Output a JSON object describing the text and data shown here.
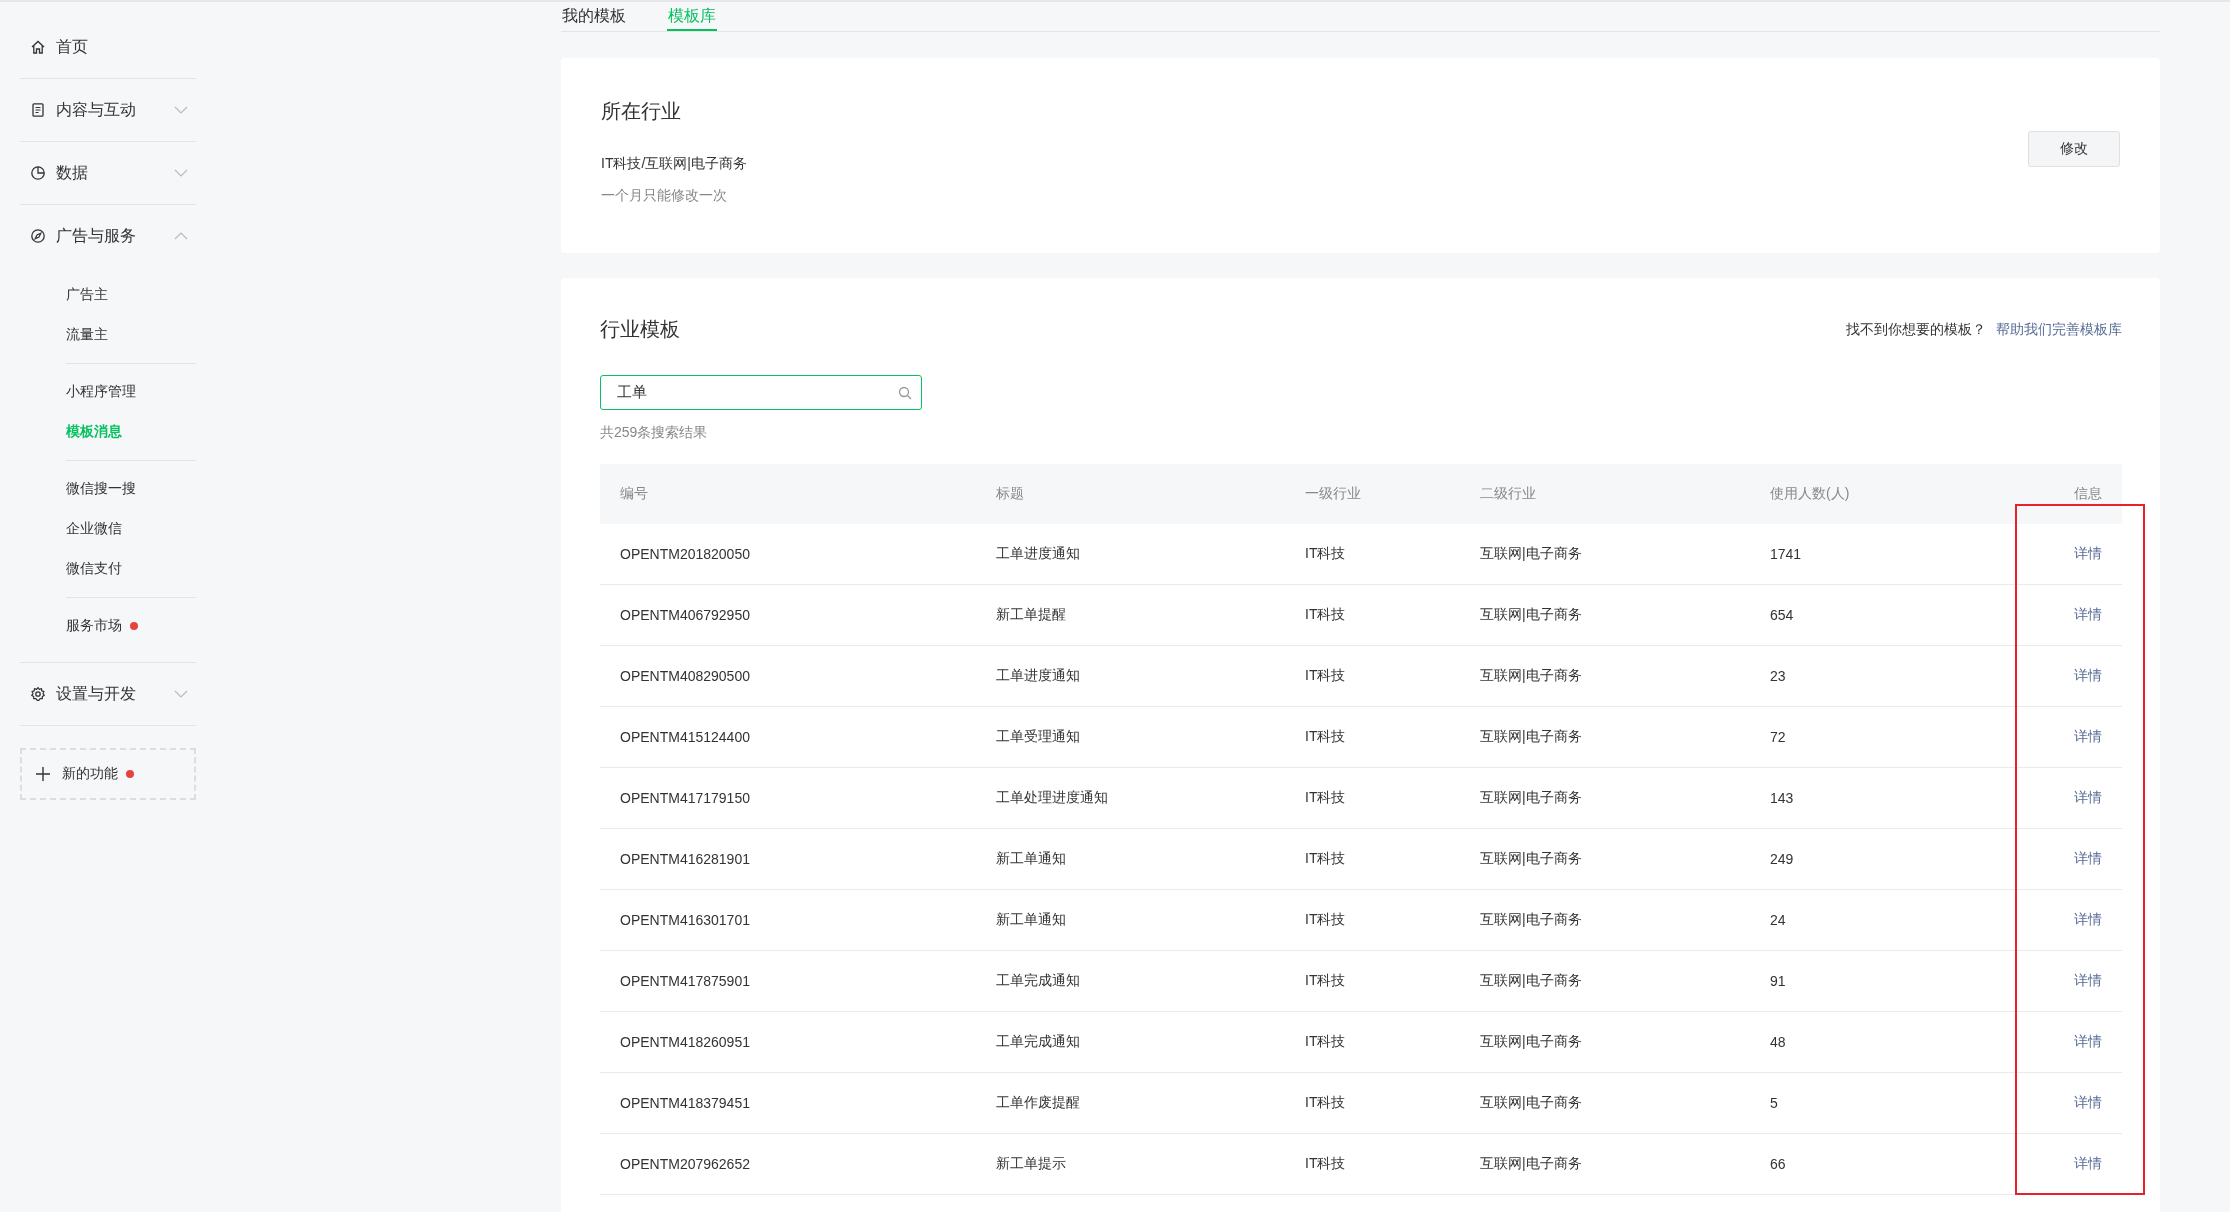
{
  "sidebar": {
    "items": [
      {
        "label": "首页"
      },
      {
        "label": "内容与互动",
        "expanded": false
      },
      {
        "label": "数据",
        "expanded": false
      },
      {
        "label": "广告与服务",
        "expanded": true,
        "groups": [
          {
            "items": [
              {
                "label": "广告主",
                "selected": false,
                "badge": false
              },
              {
                "label": "流量主",
                "selected": false,
                "badge": false
              }
            ]
          },
          {
            "items": [
              {
                "label": "小程序管理",
                "selected": false,
                "badge": false
              },
              {
                "label": "模板消息",
                "selected": true,
                "badge": false
              }
            ]
          },
          {
            "items": [
              {
                "label": "微信搜一搜",
                "selected": false,
                "badge": false
              },
              {
                "label": "企业微信",
                "selected": false,
                "badge": false
              },
              {
                "label": "微信支付",
                "selected": false,
                "badge": false
              }
            ]
          },
          {
            "items": [
              {
                "label": "服务市场",
                "selected": false,
                "badge": true
              }
            ]
          }
        ]
      },
      {
        "label": "设置与开发",
        "expanded": false
      }
    ],
    "new_feature": {
      "label": "新的功能",
      "badge": true
    }
  },
  "tabs": [
    {
      "label": "我的模板",
      "selected": false
    },
    {
      "label": "模板库",
      "selected": true
    }
  ],
  "industry_card": {
    "title": "所在行业",
    "industry": "IT科技/互联网|电子商务",
    "hint": "一个月只能修改一次",
    "button": "修改"
  },
  "template_card": {
    "title": "行业模板",
    "help_text": "找不到你想要的模板？",
    "help_link": "帮助我们完善模板库",
    "search": {
      "value": "工单"
    },
    "result_count": "共259条搜索结果",
    "table": {
      "highlight_last_column": true,
      "columns": [
        {
          "label": "编号"
        },
        {
          "label": "标题"
        },
        {
          "label": "一级行业"
        },
        {
          "label": "二级行业"
        },
        {
          "label": "使用人数(人)"
        },
        {
          "label": "信息"
        }
      ],
      "rows": [
        [
          "OPENTM201820050",
          "工单进度通知",
          "IT科技",
          "互联网|电子商务",
          "1741",
          "详情"
        ],
        [
          "OPENTM406792950",
          "新工单提醒",
          "IT科技",
          "互联网|电子商务",
          "654",
          "详情"
        ],
        [
          "OPENTM408290500",
          "工单进度通知",
          "IT科技",
          "互联网|电子商务",
          "23",
          "详情"
        ],
        [
          "OPENTM415124400",
          "工单受理通知",
          "IT科技",
          "互联网|电子商务",
          "72",
          "详情"
        ],
        [
          "OPENTM417179150",
          "工单处理进度通知",
          "IT科技",
          "互联网|电子商务",
          "143",
          "详情"
        ],
        [
          "OPENTM416281901",
          "新工单通知",
          "IT科技",
          "互联网|电子商务",
          "249",
          "详情"
        ],
        [
          "OPENTM416301701",
          "新工单通知",
          "IT科技",
          "互联网|电子商务",
          "24",
          "详情"
        ],
        [
          "OPENTM417875901",
          "工单完成通知",
          "IT科技",
          "互联网|电子商务",
          "91",
          "详情"
        ],
        [
          "OPENTM418260951",
          "工单完成通知",
          "IT科技",
          "互联网|电子商务",
          "48",
          "详情"
        ],
        [
          "OPENTM418379451",
          "工单作废提醒",
          "IT科技",
          "互联网|电子商务",
          "5",
          "详情"
        ],
        [
          "OPENTM207962652",
          "新工单提示",
          "IT科技",
          "互联网|电子商务",
          "66",
          "详情"
        ]
      ]
    }
  }
}
